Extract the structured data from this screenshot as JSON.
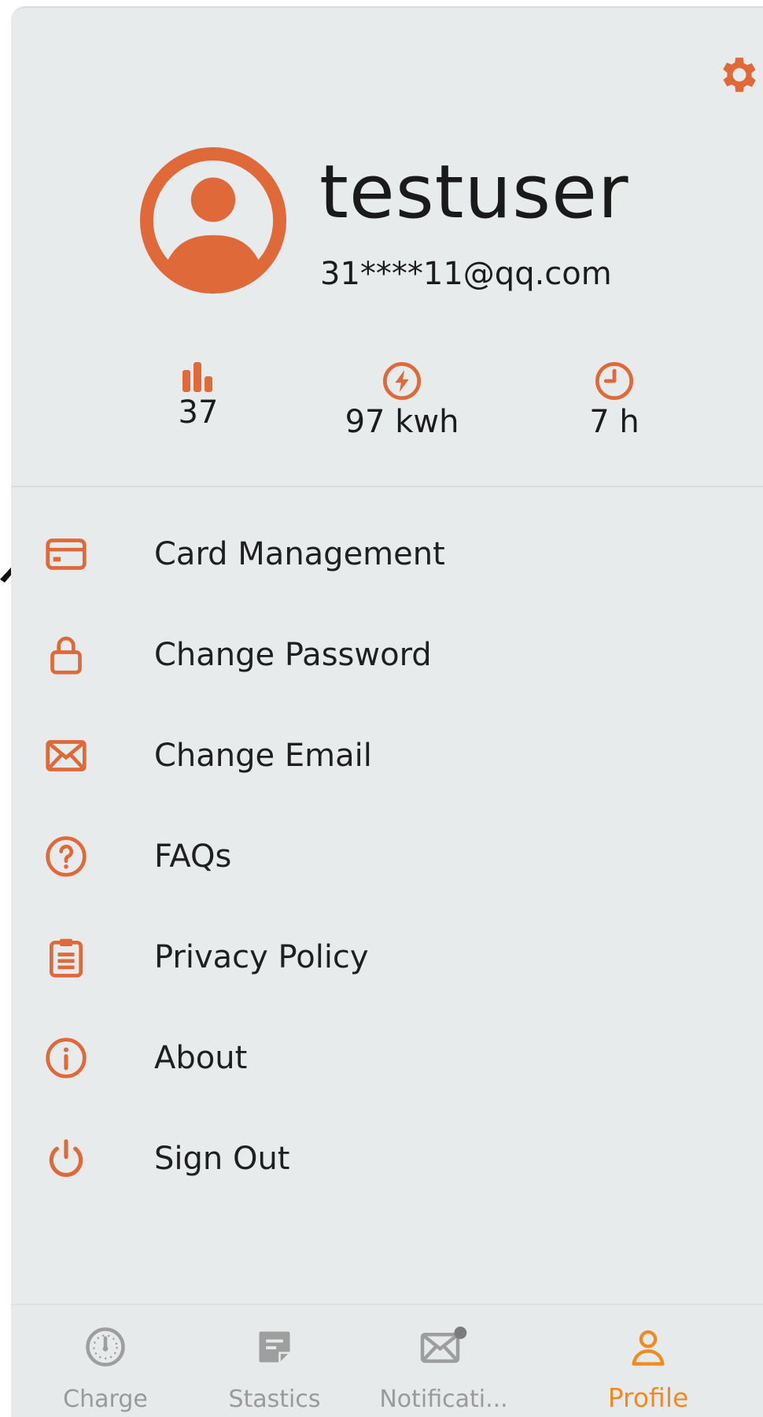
{
  "colors": {
    "accent": "#e0693a",
    "active_nav": "#f28a1f",
    "inactive_nav": "#9e9e9e",
    "background": "#e8ebec"
  },
  "header": {
    "settings_icon": "gear-icon"
  },
  "profile": {
    "avatar_icon": "user-circle-icon",
    "username": "testuser",
    "email": "31****11@qq.com"
  },
  "stats": [
    {
      "icon": "bar-chart-icon",
      "value": "37"
    },
    {
      "icon": "lightning-icon",
      "value": "97 kwh"
    },
    {
      "icon": "clock-icon",
      "value": "7 h"
    }
  ],
  "menu": [
    {
      "icon": "credit-card-icon",
      "label": "Card Management"
    },
    {
      "icon": "lock-icon",
      "label": "Change Password"
    },
    {
      "icon": "envelope-icon",
      "label": "Change Email"
    },
    {
      "icon": "question-circle-icon",
      "label": "FAQs"
    },
    {
      "icon": "clipboard-icon",
      "label": "Privacy Policy"
    },
    {
      "icon": "info-circle-icon",
      "label": "About"
    },
    {
      "icon": "power-icon",
      "label": "Sign Out"
    }
  ],
  "bottom_nav": [
    {
      "icon": "gauge-icon",
      "label": "Charge",
      "active": false
    },
    {
      "icon": "note-icon",
      "label": "Stastics",
      "active": false
    },
    {
      "icon": "mail-badge-icon",
      "label": "Notificati...",
      "active": false
    },
    {
      "icon": "person-icon",
      "label": "Profile",
      "active": true
    }
  ]
}
